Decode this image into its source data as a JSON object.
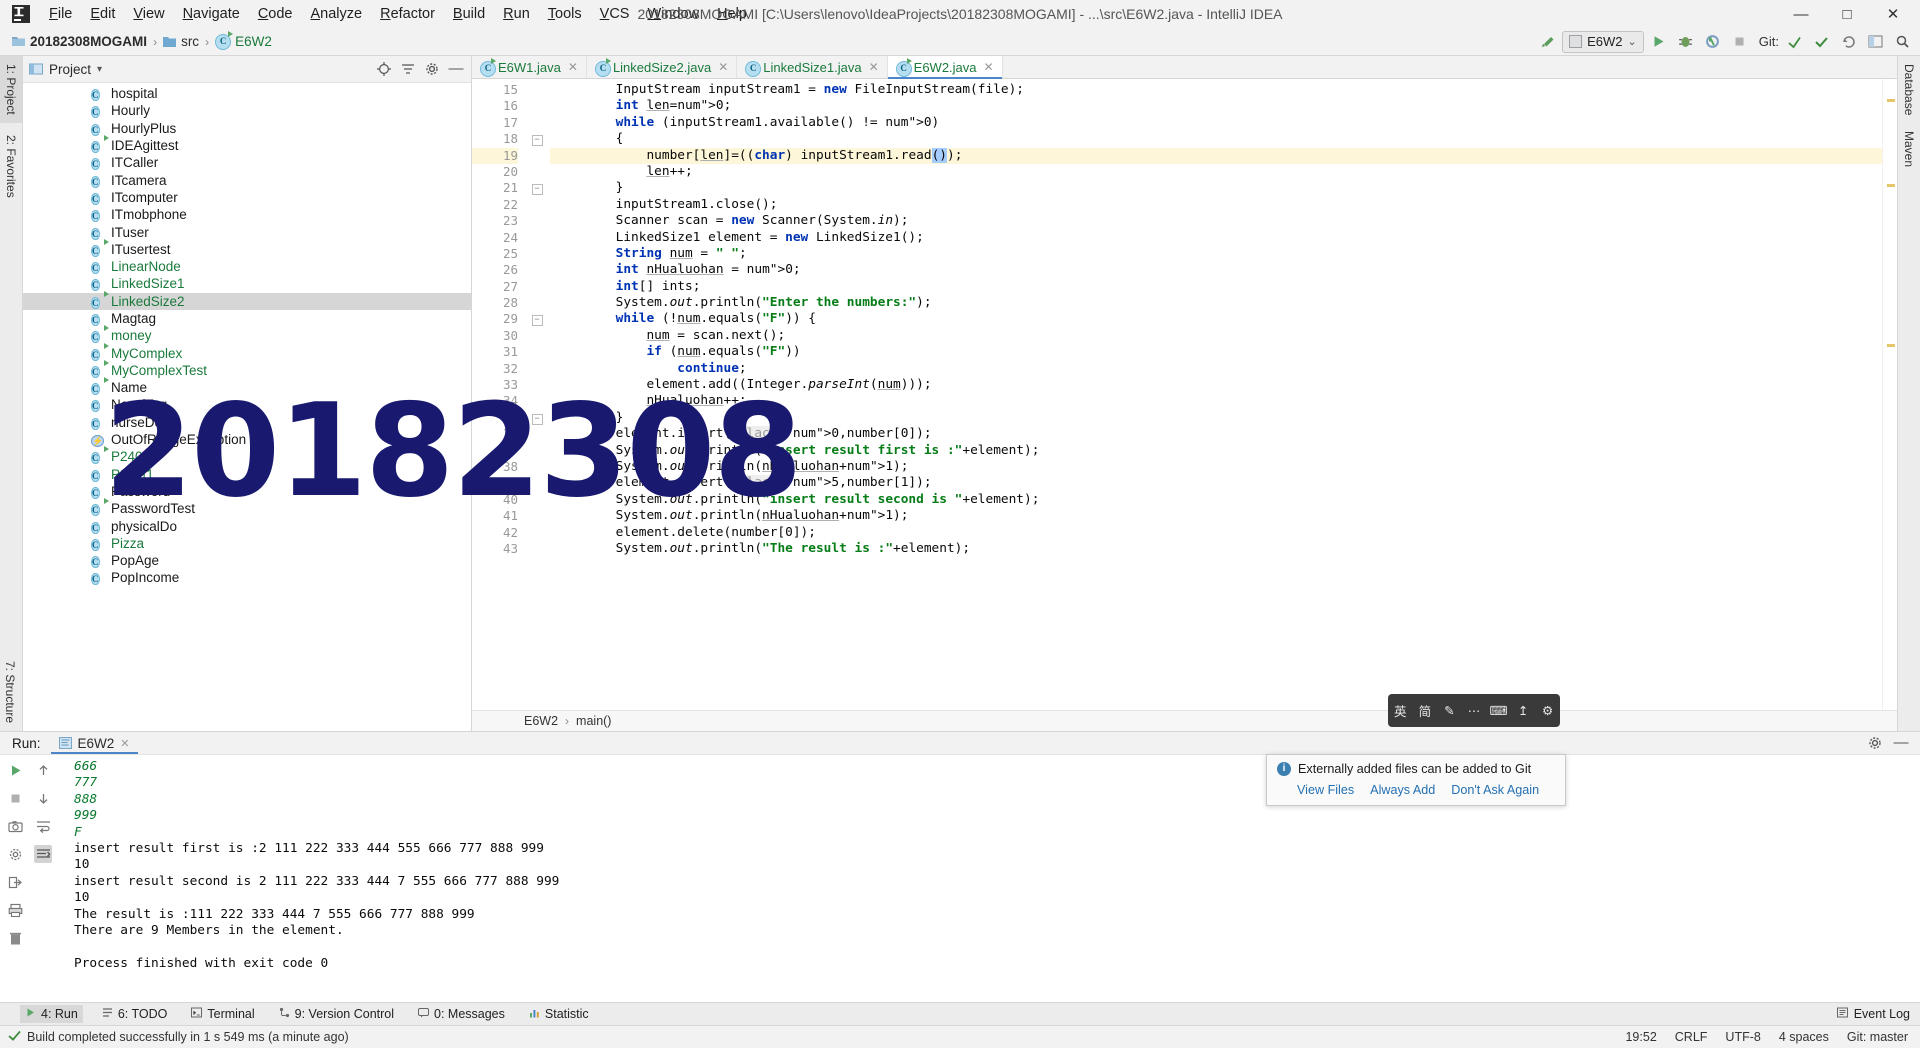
{
  "window": {
    "title": "20182308MOGAMI [C:\\Users\\lenovo\\IdeaProjects\\20182308MOGAMI] - ...\\src\\E6W2.java - IntelliJ IDEA",
    "minimize": "—",
    "maximize": "□",
    "close": "✕"
  },
  "menu": {
    "items": [
      "File",
      "Edit",
      "View",
      "Navigate",
      "Code",
      "Analyze",
      "Refactor",
      "Build",
      "Run",
      "Tools",
      "VCS",
      "Window",
      "Help"
    ]
  },
  "breadcrumb": {
    "project": "20182308MOGAMI",
    "folder": "src",
    "file": "E6W2",
    "separator": "›"
  },
  "toolbar": {
    "run_config": "E6W2",
    "dropdown_caret": "⌄",
    "git_label": "Git:",
    "icons": [
      "back-arrow-icon",
      "run-icon",
      "debug-icon",
      "run-with-coverage-icon",
      "stop-icon",
      "git-update-icon",
      "git-commit-icon",
      "git-rollback-icon",
      "search-everywhere-icon",
      "settings-icon"
    ]
  },
  "rail_left": {
    "top": [
      {
        "label": "1: Project",
        "icon": "project-icon",
        "active": true
      },
      {
        "label": "2: Favorites",
        "icon": "star-icon",
        "active": false
      }
    ],
    "bottom": [
      {
        "label": "7: Structure",
        "icon": "structure-icon",
        "active": false
      }
    ]
  },
  "rail_right": {
    "items": [
      {
        "label": "Database",
        "icon": "database-icon"
      },
      {
        "label": "Maven",
        "icon": "maven-icon"
      }
    ]
  },
  "project_panel": {
    "title": "Project",
    "caret": "▾",
    "head_icons": [
      "target-icon",
      "collapse-all-icon",
      "gear-icon",
      "hide-icon"
    ],
    "tree": [
      {
        "name": "hospital",
        "kind": "class",
        "green": false,
        "runnable": false,
        "selected": false
      },
      {
        "name": "Hourly",
        "kind": "class",
        "green": false,
        "runnable": false,
        "selected": false
      },
      {
        "name": "HourlyPlus",
        "kind": "class",
        "green": false,
        "runnable": false,
        "selected": false
      },
      {
        "name": "IDEAgittest",
        "kind": "class",
        "green": false,
        "runnable": true,
        "selected": false
      },
      {
        "name": "ITCaller",
        "kind": "class",
        "green": false,
        "runnable": false,
        "selected": false
      },
      {
        "name": "ITcamera",
        "kind": "class",
        "green": false,
        "runnable": false,
        "selected": false
      },
      {
        "name": "ITcomputer",
        "kind": "class",
        "green": false,
        "runnable": false,
        "selected": false
      },
      {
        "name": "ITmobphone",
        "kind": "class",
        "green": false,
        "runnable": false,
        "selected": false
      },
      {
        "name": "ITuser",
        "kind": "class",
        "green": false,
        "runnable": false,
        "selected": false
      },
      {
        "name": "ITusertest",
        "kind": "class",
        "green": false,
        "runnable": true,
        "selected": false
      },
      {
        "name": "LinearNode",
        "kind": "class",
        "green": true,
        "runnable": false,
        "selected": false
      },
      {
        "name": "LinkedSize1",
        "kind": "class",
        "green": true,
        "runnable": false,
        "selected": false
      },
      {
        "name": "LinkedSize2",
        "kind": "class",
        "green": true,
        "runnable": true,
        "selected": true
      },
      {
        "name": "Magtag",
        "kind": "class",
        "green": false,
        "runnable": false,
        "selected": false
      },
      {
        "name": "money",
        "kind": "class",
        "green": true,
        "runnable": true,
        "selected": false
      },
      {
        "name": "MyComplex",
        "kind": "class",
        "green": true,
        "runnable": true,
        "selected": false
      },
      {
        "name": "MyComplexTest",
        "kind": "class",
        "green": true,
        "runnable": true,
        "selected": false
      },
      {
        "name": "Name",
        "kind": "class",
        "green": false,
        "runnable": true,
        "selected": false
      },
      {
        "name": "NovelTag",
        "kind": "class",
        "green": false,
        "runnable": false,
        "selected": false
      },
      {
        "name": "nurseDo",
        "kind": "class",
        "green": false,
        "runnable": false,
        "selected": false
      },
      {
        "name": "OutOfRangeException",
        "kind": "exception",
        "green": false,
        "runnable": false,
        "selected": false
      },
      {
        "name": "P240t1",
        "kind": "class",
        "green": true,
        "runnable": true,
        "selected": false
      },
      {
        "name": "P241t1",
        "kind": "class",
        "green": true,
        "runnable": false,
        "selected": false
      },
      {
        "name": "Password",
        "kind": "class",
        "green": false,
        "runnable": false,
        "selected": false
      },
      {
        "name": "PasswordTest",
        "kind": "class",
        "green": false,
        "runnable": true,
        "selected": false
      },
      {
        "name": "physicalDo",
        "kind": "class",
        "green": false,
        "runnable": false,
        "selected": false
      },
      {
        "name": "Pizza",
        "kind": "class",
        "green": true,
        "runnable": false,
        "selected": false
      },
      {
        "name": "PopAge",
        "kind": "class",
        "green": false,
        "runnable": false,
        "selected": false
      },
      {
        "name": "PopIncome",
        "kind": "class",
        "green": false,
        "runnable": false,
        "selected": false
      }
    ]
  },
  "editor": {
    "tabs": [
      {
        "label": "E6W1.java",
        "green": true,
        "runnable": true,
        "active": false
      },
      {
        "label": "LinkedSize2.java",
        "green": true,
        "runnable": true,
        "active": false
      },
      {
        "label": "LinkedSize1.java",
        "green": true,
        "runnable": false,
        "active": false
      },
      {
        "label": "E6W2.java",
        "green": true,
        "runnable": true,
        "active": true
      }
    ],
    "close_glyph": "✕",
    "first_line_number": 15,
    "lines": [
      {
        "n": 15,
        "fold": "",
        "highlight": false
      },
      {
        "n": 16,
        "fold": "",
        "highlight": false
      },
      {
        "n": 17,
        "fold": "",
        "highlight": false
      },
      {
        "n": 18,
        "fold": "-",
        "highlight": false
      },
      {
        "n": 19,
        "fold": "",
        "highlight": true
      },
      {
        "n": 20,
        "fold": "",
        "highlight": false
      },
      {
        "n": 21,
        "fold": "-",
        "highlight": false
      },
      {
        "n": 22,
        "fold": "",
        "highlight": false
      },
      {
        "n": 23,
        "fold": "",
        "highlight": false
      },
      {
        "n": 24,
        "fold": "",
        "highlight": false
      },
      {
        "n": 25,
        "fold": "",
        "highlight": false
      },
      {
        "n": 26,
        "fold": "",
        "highlight": false
      },
      {
        "n": 27,
        "fold": "",
        "highlight": false
      },
      {
        "n": 28,
        "fold": "",
        "highlight": false
      },
      {
        "n": 29,
        "fold": "-",
        "highlight": false
      },
      {
        "n": 30,
        "fold": "",
        "highlight": false
      },
      {
        "n": 31,
        "fold": "",
        "highlight": false
      },
      {
        "n": 32,
        "fold": "",
        "highlight": false
      },
      {
        "n": 33,
        "fold": "",
        "highlight": false
      },
      {
        "n": 34,
        "fold": "",
        "highlight": false
      },
      {
        "n": 35,
        "fold": "-",
        "highlight": false
      },
      {
        "n": 36,
        "fold": "",
        "highlight": false
      },
      {
        "n": 37,
        "fold": "",
        "highlight": false
      },
      {
        "n": 38,
        "fold": "",
        "highlight": false
      },
      {
        "n": 39,
        "fold": "",
        "highlight": false
      },
      {
        "n": 40,
        "fold": "",
        "highlight": false
      },
      {
        "n": 41,
        "fold": "",
        "highlight": false
      },
      {
        "n": 42,
        "fold": "",
        "highlight": false
      },
      {
        "n": 43,
        "fold": "",
        "highlight": false
      }
    ],
    "source": [
      "        InputStream inputStream1 = new FileInputStream(file);",
      "        int len=0;",
      "        while (inputStream1.available() != 0)",
      "        {",
      "            number[len]=((char) inputStream1.read());",
      "            len++;",
      "        }",
      "        inputStream1.close();",
      "        Scanner scan = new Scanner(System.in);",
      "        LinkedSize1 element = new LinkedSize1();",
      "        String num = \" \";",
      "        int nHualuohan = 0;",
      "        int[] ints;",
      "        System.out.println(\"Enter the numbers:\");",
      "        while (!num.equals(\"F\")) {",
      "            num = scan.next();",
      "            if (num.equals(\"F\"))",
      "                continue;",
      "            element.add((Integer.parseInt(num)));",
      "            nHualuohan++;",
      "        }",
      "        element.insert( place: 0,number[0]);",
      "        System.out.println(\"insert result first is :\"+element);",
      "        System.out.println(nHualuohan+1);",
      "        element.insert( place: 5,number[1]);",
      "        System.out.println(\"insert result second is \"+element);",
      "        System.out.println(nHualuohan+1);",
      "        element.delete(number[0]);",
      "        System.out.println(\"The result is :\"+element);"
    ],
    "bottom_breadcrumb": [
      "E6W2",
      "main()"
    ],
    "bottom_breadcrumb_sep": "›"
  },
  "run_panel": {
    "label": "Run:",
    "tab": "E6W2",
    "close_glyph": "✕",
    "head_icons": [
      "gear-icon",
      "hide-icon"
    ],
    "side_icons": [
      "rerun-icon",
      "stop-icon",
      "screenshot-icon",
      "settings-icon",
      "scroll-up-icon",
      "scroll-down-icon",
      "soft-wrap-icon",
      "scroll-to-end-icon",
      "export-icon",
      "print-icon",
      "trash-icon"
    ],
    "output": [
      {
        "text": "666",
        "style": "input"
      },
      {
        "text": "777",
        "style": "input"
      },
      {
        "text": "888",
        "style": "input"
      },
      {
        "text": "999",
        "style": "input"
      },
      {
        "text": "F",
        "style": "input"
      },
      {
        "text": "insert result first is :2 111 222 333 444 555 666 777 888 999",
        "style": "out"
      },
      {
        "text": "10",
        "style": "out"
      },
      {
        "text": "insert result second is 2 111 222 333 444 7 555 666 777 888 999",
        "style": "out"
      },
      {
        "text": "10",
        "style": "out"
      },
      {
        "text": "The result is :111 222 333 444 7 555 666 777 888 999",
        "style": "out"
      },
      {
        "text": "There are 9 Members in the element.",
        "style": "out"
      },
      {
        "text": "",
        "style": "out"
      },
      {
        "text": "Process finished with exit code 0",
        "style": "out"
      }
    ]
  },
  "toolwindow_bar": {
    "items": [
      {
        "label": "4: Run",
        "icon": "run-icon",
        "active": true
      },
      {
        "label": "6: TODO",
        "icon": "todo-icon",
        "active": false
      },
      {
        "label": "Terminal",
        "icon": "terminal-icon",
        "active": false
      },
      {
        "label": "9: Version Control",
        "icon": "vcs-icon",
        "active": false
      },
      {
        "label": "0: Messages",
        "icon": "messages-icon",
        "active": false
      },
      {
        "label": "Statistic",
        "icon": "statistic-icon",
        "active": false
      }
    ],
    "event_log": "Event Log"
  },
  "status_bar": {
    "message": "Build completed successfully in 1 s 549 ms (a minute ago)",
    "time": "19:52",
    "line_sep": "CRLF",
    "encoding": "UTF-8",
    "indent": "4 spaces",
    "branch": "Git: master"
  },
  "watermark": {
    "text": "20182308",
    "color": "#191970"
  },
  "ime_bar": {
    "items": [
      "英",
      "简",
      "✎",
      "⋯",
      "⌨",
      "↥",
      "⚙"
    ]
  },
  "notification": {
    "icon": "info-icon",
    "message": "Externally added files can be added to Git",
    "links": [
      "View Files",
      "Always Add",
      "Don't Ask Again"
    ]
  }
}
